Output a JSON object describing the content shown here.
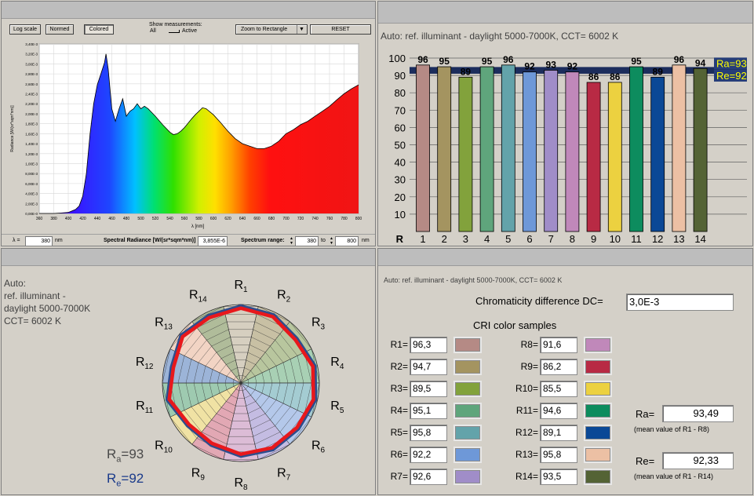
{
  "spectrum": {
    "buttons": {
      "log_scale": "Log scale",
      "normed": "Normed",
      "colored": "Colored"
    },
    "show_measurements": {
      "label": "Show measurements:",
      "all": "All",
      "active": "Active"
    },
    "zoom_select": "Zoom to Rectangle",
    "reset": "RESET",
    "footer": {
      "lambda_label": "λ =",
      "lambda_value": "380",
      "lambda_unit": "nm",
      "radiance_label": "Spectral Radiance [W/(sr*sqm*nm)]",
      "radiance_value": "3,855E-6",
      "range_label": "Spectrum range:",
      "range_from": "380",
      "range_to_label": "to",
      "range_to": "800",
      "range_unit": "nm"
    }
  },
  "chart_data": [
    {
      "type": "area",
      "title": "",
      "xlabel": "λ [nm]",
      "ylabel": "Radiance [W/(sr*sqm*nm)]",
      "xlim": [
        360,
        800
      ],
      "ylim": [
        0,
        0.0034
      ],
      "x_ticks": [
        "360",
        "380",
        "400",
        "420",
        "440",
        "460",
        "480",
        "500",
        "520",
        "540",
        "560",
        "580",
        "600",
        "620",
        "640",
        "660",
        "680",
        "700",
        "720",
        "740",
        "760",
        "780",
        "800"
      ],
      "y_ticks": [
        "0,00E-0",
        "2,00E-3",
        "4,00E-3",
        "6,00E-3",
        "8,00E-3",
        "1,00E-3",
        "1,20E-3",
        "1,40E-3",
        "1,60E-3",
        "1,80E-3",
        "2,00E-3",
        "2,20E-3",
        "2,40E-3",
        "2,60E-3",
        "2,80E-3",
        "3,00E-3",
        "3,20E-3",
        "3,40E-3"
      ],
      "x": [
        360,
        380,
        390,
        400,
        410,
        415,
        420,
        425,
        430,
        435,
        440,
        445,
        450,
        452,
        455,
        460,
        465,
        470,
        475,
        480,
        485,
        490,
        495,
        500,
        505,
        510,
        520,
        530,
        540,
        545,
        550,
        555,
        560,
        570,
        575,
        580,
        585,
        590,
        600,
        610,
        620,
        630,
        640,
        650,
        660,
        670,
        680,
        690,
        700,
        710,
        720,
        730,
        740,
        750,
        760,
        770,
        780,
        790,
        800
      ],
      "values": [
        0,
        0,
        1e-05,
        2e-05,
        8e-05,
        0.00015,
        0.00035,
        0.0008,
        0.0016,
        0.0022,
        0.00258,
        0.0028,
        0.00303,
        0.0032,
        0.0029,
        0.0021,
        0.00185,
        0.0021,
        0.0023,
        0.00195,
        0.00205,
        0.0021,
        0.0022,
        0.0021,
        0.00215,
        0.0021,
        0.00195,
        0.00178,
        0.00163,
        0.00158,
        0.0016,
        0.00165,
        0.00172,
        0.0019,
        0.00198,
        0.00205,
        0.00212,
        0.0021,
        0.00198,
        0.00182,
        0.00165,
        0.0015,
        0.0014,
        0.00135,
        0.0013,
        0.0013,
        0.00135,
        0.00145,
        0.0016,
        0.00168,
        0.00178,
        0.00185,
        0.00195,
        0.00205,
        0.00215,
        0.00228,
        0.0024,
        0.0025,
        0.00258
      ]
    },
    {
      "type": "bar",
      "title": "Auto: ref. illuminant - daylight 5000-7000K, CCT= 6002 K",
      "x_axis_title": "R",
      "categories": [
        "1",
        "2",
        "3",
        "4",
        "5",
        "6",
        "7",
        "8",
        "9",
        "10",
        "11",
        "12",
        "13",
        "14"
      ],
      "values": [
        96,
        95,
        89,
        95,
        96,
        92,
        93,
        92,
        86,
        86,
        95,
        89,
        96,
        94
      ],
      "colors": [
        "#b58a85",
        "#a49460",
        "#82a23c",
        "#5fa57c",
        "#63a3aa",
        "#6e98d8",
        "#a08dc8",
        "#c088ba",
        "#b82a44",
        "#ecd140",
        "#0d8c5e",
        "#0a4896",
        "#ecc0a4",
        "#546335"
      ],
      "y_ticks": [
        "10",
        "20",
        "30",
        "40",
        "50",
        "60",
        "70",
        "80",
        "90",
        "100"
      ],
      "ylim": [
        0,
        100
      ],
      "reference_lines": [
        {
          "label": "Ra=93",
          "value": 93.49,
          "color": "#1c2d5c",
          "label_color": "#ffff00"
        },
        {
          "label": "Re=92",
          "value": 92.33,
          "color": "#263d78",
          "label_color": "#ffff00"
        }
      ]
    },
    {
      "type": "radar",
      "categories": [
        "R1",
        "R2",
        "R3",
        "R4",
        "R5",
        "R6",
        "R7",
        "R8",
        "R9",
        "R10",
        "R11",
        "R12",
        "R13",
        "R14"
      ],
      "values": [
        96.3,
        94.7,
        89.5,
        95.1,
        95.8,
        92.2,
        92.6,
        91.6,
        86.2,
        85.5,
        94.6,
        89.1,
        95.8,
        93.5
      ],
      "range": [
        0,
        100
      ],
      "ra_label": "Ra=93",
      "re_label": "Re=92"
    }
  ],
  "bars_panel": {
    "title": "Auto: ref. illuminant - daylight 5000-7000K, CCT= 6002 K"
  },
  "polar_panel": {
    "auto_lines": [
      "Auto:",
      "ref. illuminant -",
      "daylight 5000-7000K",
      "CCT= 6002 K"
    ],
    "ra_prefix": "R",
    "ra_sub": "a",
    "ra_value": "=93",
    "re_prefix": "R",
    "re_sub": "e",
    "re_value": "=92"
  },
  "table_panel": {
    "header": "Auto: ref. illuminant - daylight 5000-7000K, CCT= 6002 K",
    "dc_label": "Chromaticity difference DC=",
    "dc_value": "3,0E-3",
    "samples_title": "CRI color samples",
    "left": [
      {
        "label": "R1=",
        "value": "96,3",
        "color": "#b58a85"
      },
      {
        "label": "R2=",
        "value": "94,7",
        "color": "#a49460"
      },
      {
        "label": "R3=",
        "value": "89,5",
        "color": "#82a23c"
      },
      {
        "label": "R4=",
        "value": "95,1",
        "color": "#5fa57c"
      },
      {
        "label": "R5=",
        "value": "95,8",
        "color": "#63a3aa"
      },
      {
        "label": "R6=",
        "value": "92,2",
        "color": "#6e98d8"
      },
      {
        "label": "R7=",
        "value": "92,6",
        "color": "#a08dc8"
      }
    ],
    "right": [
      {
        "label": "R8=",
        "value": "91,6",
        "color": "#c088ba"
      },
      {
        "label": "R9=",
        "value": "86,2",
        "color": "#b82a44"
      },
      {
        "label": "R10=",
        "value": "85,5",
        "color": "#ecd140"
      },
      {
        "label": "R11=",
        "value": "94,6",
        "color": "#0d8c5e"
      },
      {
        "label": "R12=",
        "value": "89,1",
        "color": "#0a4896"
      },
      {
        "label": "R13=",
        "value": "95,8",
        "color": "#ecc0a4"
      },
      {
        "label": "R14=",
        "value": "93,5",
        "color": "#546335"
      }
    ],
    "ra_label": "Ra=",
    "ra_value": "93,49",
    "ra_note": "(mean value of R1 - R8)",
    "re_label": "Re=",
    "re_value": "92,33",
    "re_note": "(mean value of R1 - R14)"
  }
}
